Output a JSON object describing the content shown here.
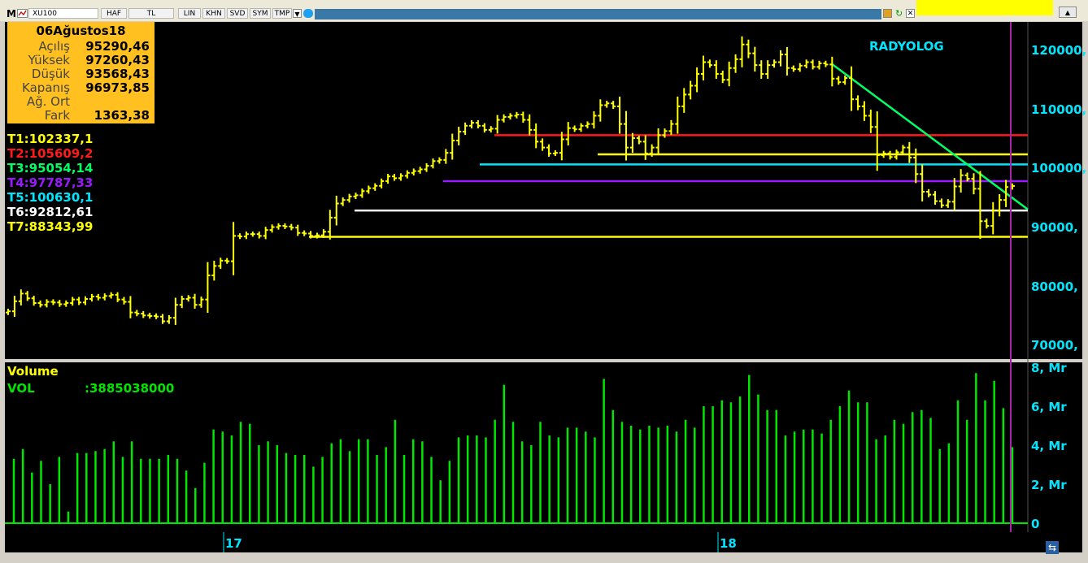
{
  "toolbar": {
    "menu_letter": "M",
    "symbol": "XU100",
    "buttons": [
      "HAF",
      "TL",
      "LIN",
      "KHN",
      "SVD",
      "SYM",
      "TMP"
    ]
  },
  "watermark": "RADYOLOG",
  "info": {
    "date": "06Ağustos18",
    "rows": [
      {
        "label": "Açılış",
        "value": "95290,46"
      },
      {
        "label": "Yüksek",
        "value": "97260,43"
      },
      {
        "label": "Düşük",
        "value": "93568,43"
      },
      {
        "label": "Kapanış",
        "value": "96973,85"
      },
      {
        "label": "Ağ. Ort",
        "value": ""
      },
      {
        "label": "Fark",
        "value": "1363,38"
      }
    ]
  },
  "trend_lines": [
    {
      "label": "T1:102337,1",
      "value": 102337.1,
      "color": "#ffff00"
    },
    {
      "label": "T2:105609,2",
      "value": 105609.2,
      "color": "#ff1a1a"
    },
    {
      "label": "T3:95054,14",
      "value": 95054.14,
      "color": "#00ff66"
    },
    {
      "label": "T4:97787,33",
      "value": 97787.33,
      "color": "#9a1aff"
    },
    {
      "label": "T5:100630,1",
      "value": 100630.1,
      "color": "#00e6ff"
    },
    {
      "label": "T6:92812,61",
      "value": 92812.61,
      "color": "#ffffff"
    },
    {
      "label": "T7:88343,99",
      "value": 88343.99,
      "color": "#ffff00"
    }
  ],
  "volume_panel": {
    "title": "Volume",
    "vol_label": "VOL",
    "vol_value": ":3885038000"
  },
  "x_axis": {
    "labels": [
      "17",
      "18"
    ]
  },
  "chart_data": [
    {
      "type": "ohlc",
      "series_name": "XU100",
      "y_axis_labels": [
        "120000,",
        "110000,",
        "100000,",
        "90000,",
        "80000,",
        "70000,"
      ],
      "ylim": [
        67500,
        125000
      ],
      "grid": false,
      "colors": {
        "bars": "#ffff00",
        "background": "#000000",
        "axis_text": "#00e6ff"
      },
      "closes": [
        75700,
        77400,
        78700,
        77900,
        77100,
        76800,
        77300,
        77200,
        76900,
        77100,
        77700,
        77200,
        77800,
        78200,
        78000,
        78300,
        78500,
        77700,
        77300,
        75500,
        75300,
        75000,
        74900,
        74800,
        74000,
        74600,
        76800,
        77800,
        78000,
        76800,
        77700,
        81800,
        83400,
        84300,
        84200,
        88500,
        88400,
        88800,
        88800,
        88500,
        89500,
        90000,
        90200,
        90100,
        89900,
        89000,
        88900,
        88500,
        88600,
        89200,
        91600,
        94000,
        94600,
        95200,
        95400,
        96100,
        96600,
        97000,
        97800,
        98600,
        98300,
        98700,
        99200,
        99500,
        99800,
        100400,
        101200,
        101400,
        102600,
        104700,
        106200,
        107200,
        107700,
        107200,
        106500,
        106700,
        108200,
        108700,
        108900,
        109100,
        108200,
        106500,
        104500,
        103500,
        102500,
        102600,
        104900,
        106800,
        106600,
        107200,
        107500,
        108900,
        110700,
        111000,
        110500,
        107500,
        103500,
        105100,
        104500,
        102500,
        103500,
        105600,
        106300,
        107500,
        110500,
        112500,
        114000,
        116000,
        118000,
        117500,
        116000,
        115000,
        117000,
        118500,
        121000,
        119500,
        117500,
        116000,
        117500,
        118000,
        119300,
        117000,
        116800,
        117400,
        118000,
        117200,
        117800,
        117600,
        115200,
        114600,
        115300,
        111700,
        110500,
        108900,
        107000,
        102200,
        102500,
        101900,
        102700,
        103500,
        101800,
        99000,
        96000,
        95500,
        94400,
        93700,
        94300,
        96900,
        98800,
        98200,
        96500,
        91000,
        90200,
        92800,
        94600,
        96800,
        96974
      ],
      "annotations": [
        "RADYOLOG"
      ]
    },
    {
      "type": "bar",
      "series_name": "Volume",
      "unit": "Mr",
      "y_axis_labels": [
        "8, Mr",
        "6, Mr",
        "4, Mr",
        "2, Mr",
        "0"
      ],
      "ylim": [
        0,
        8
      ],
      "last_value": 3885038000,
      "colors": {
        "bars": "#00e600"
      },
      "values": [
        3.3,
        3.8,
        2.6,
        3.2,
        2.0,
        3.4,
        0.6,
        3.6,
        3.6,
        3.7,
        3.8,
        4.2,
        3.4,
        4.2,
        3.3,
        3.3,
        3.3,
        3.5,
        3.3,
        2.7,
        1.8,
        3.1,
        4.8,
        4.7,
        4.5,
        5.2,
        5.1,
        4.0,
        4.2,
        4.0,
        3.6,
        3.5,
        3.5,
        2.9,
        3.4,
        4.1,
        4.3,
        3.7,
        4.3,
        4.3,
        3.5,
        3.9,
        5.3,
        3.5,
        4.3,
        4.2,
        3.4,
        2.2,
        3.2,
        4.4,
        4.5,
        4.5,
        4.4,
        5.3,
        7.1,
        5.2,
        4.2,
        4.0,
        5.2,
        4.5,
        4.4,
        4.9,
        4.9,
        4.7,
        4.4,
        7.4,
        5.8,
        5.2,
        5.0,
        4.8,
        5.0,
        4.9,
        5.0,
        4.7,
        5.3,
        4.9,
        6.0,
        6.0,
        6.3,
        6.2,
        6.5,
        7.6,
        6.6,
        5.8,
        5.8,
        4.5,
        4.7,
        4.8,
        4.8,
        4.6,
        5.3,
        6.0,
        6.8,
        6.2,
        6.2,
        4.3,
        4.5,
        5.3,
        5.1,
        5.7,
        5.8,
        5.4,
        3.8,
        4.1,
        6.3,
        5.3,
        7.7,
        6.3,
        7.3,
        5.9,
        3.9
      ]
    }
  ]
}
